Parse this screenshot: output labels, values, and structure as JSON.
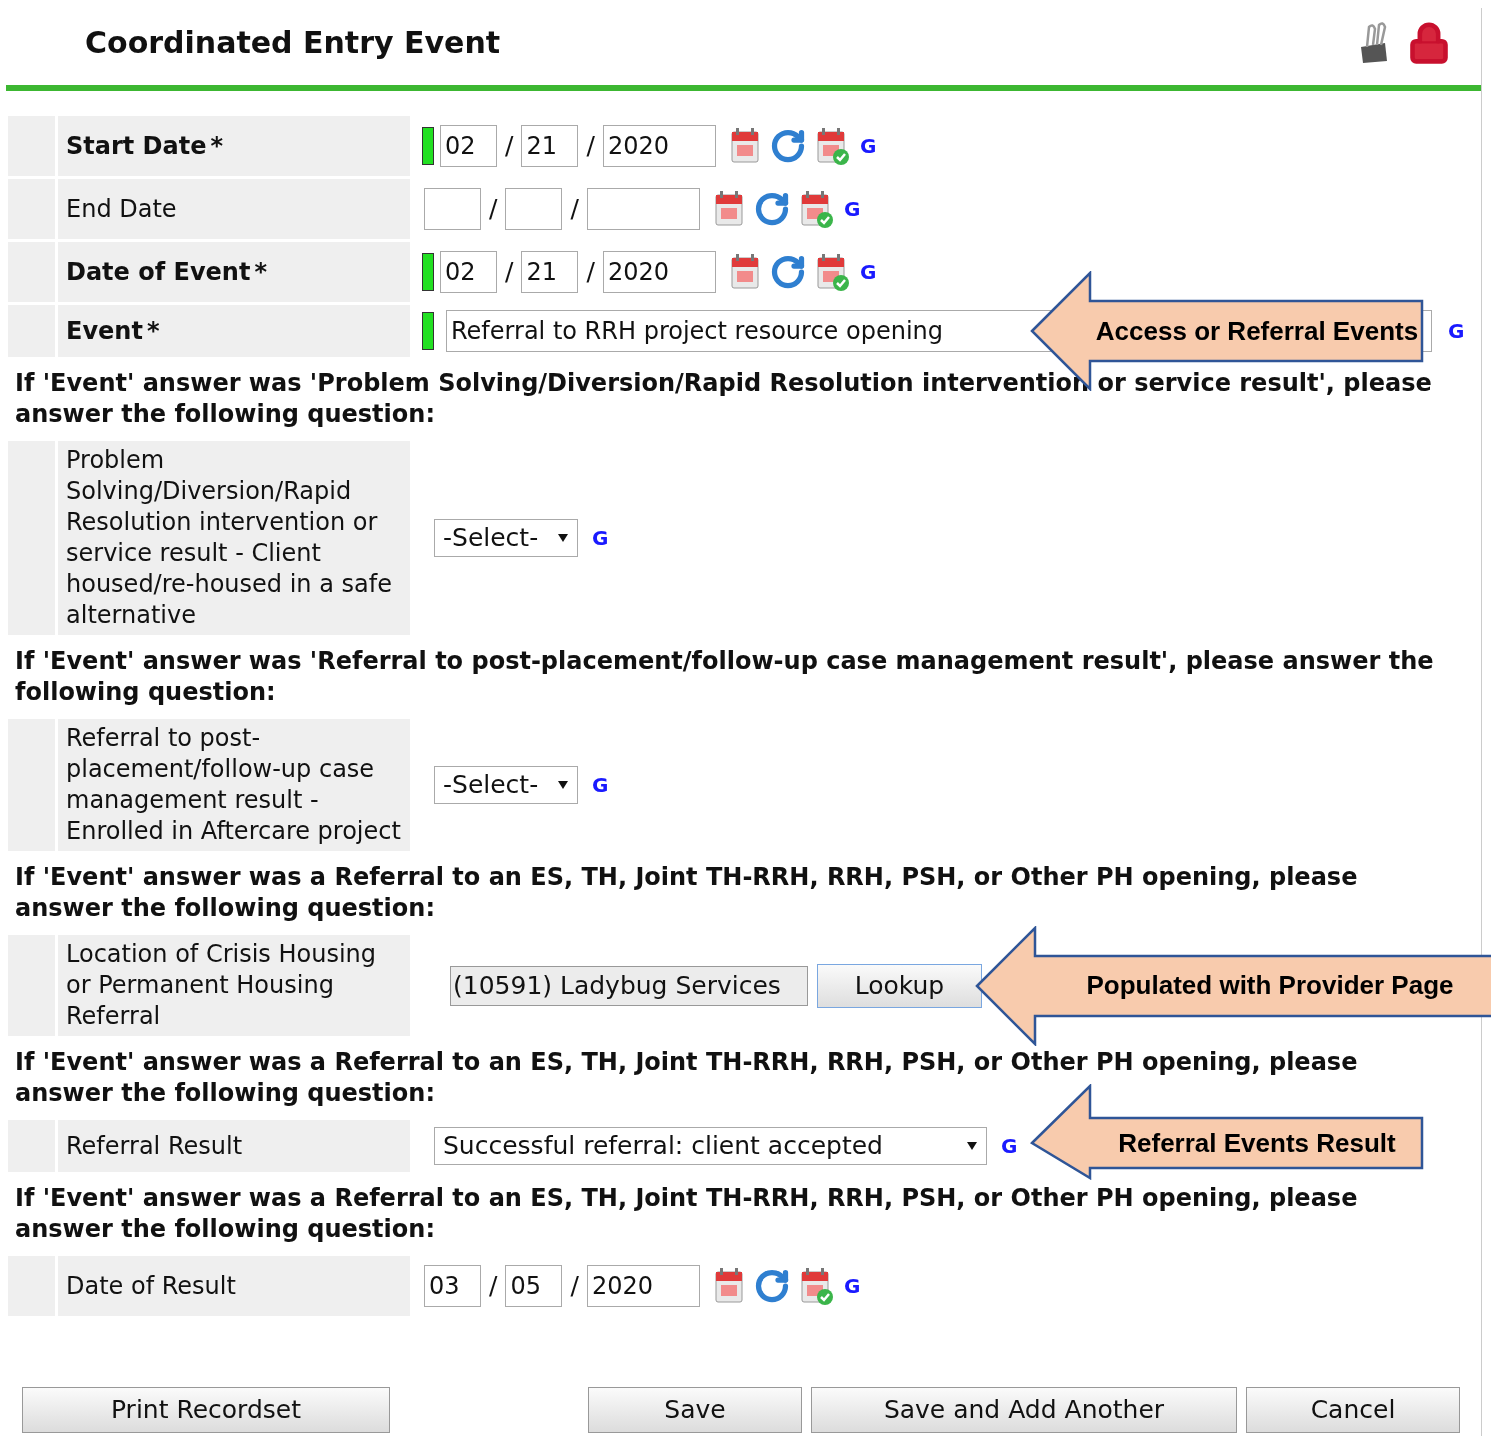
{
  "title": "Coordinated Entry Event",
  "date_separator": "/",
  "items": [
    {
      "kind": "date",
      "label": "Start Date",
      "required": true,
      "required_mark": "*",
      "month": "02",
      "day": "21",
      "year": "2020",
      "g": "G"
    },
    {
      "kind": "date",
      "label": "End Date",
      "required": false,
      "g": "G"
    },
    {
      "kind": "date",
      "label": "Date of Event",
      "required": true,
      "required_mark": "*",
      "month": "02",
      "day": "21",
      "year": "2020",
      "g": "G"
    },
    {
      "kind": "text",
      "label": "Event",
      "required": true,
      "required_mark": "*",
      "value": "Referral to RRH project resource opening",
      "g": "G",
      "callout": "Access or Referral Events"
    },
    {
      "kind": "heading",
      "text": "If 'Event' answer was 'Problem Solving/Diversion/Rapid Resolution intervention or service result', please answer the following question:"
    },
    {
      "kind": "select",
      "label": "Problem Solving/Diversion/Rapid Resolution intervention or service result - Client housed/re-housed in a safe alternative",
      "required": false,
      "value": "-Select-",
      "g": "G"
    },
    {
      "kind": "heading",
      "text": "If 'Event' answer was 'Referral to post-placement/follow-up case management result', please answer the following question:"
    },
    {
      "kind": "select",
      "label": "Referral to post-placement/follow-up case management result - Enrolled in Aftercare project",
      "required": false,
      "value": "-Select-",
      "g": "G"
    },
    {
      "kind": "heading",
      "text": "If 'Event' answer was a Referral to an ES, TH, Joint TH-RRH, RRH, PSH, or Other PH opening, please answer the following question:"
    },
    {
      "kind": "lookup",
      "label": "Location of Crisis Housing or Permanent Housing Referral",
      "required": false,
      "value": "(10591) Ladybug Services",
      "button": "Lookup",
      "callout": "Populated with Provider Page"
    },
    {
      "kind": "heading",
      "text": "If 'Event' answer was a Referral to an ES, TH, Joint TH-RRH, RRH, PSH, or Other PH opening, please answer the following question:"
    },
    {
      "kind": "select",
      "label": "Referral Result",
      "required": false,
      "value": "Successful referral: client accepted",
      "g": "G",
      "callout": "Referral Events Result"
    },
    {
      "kind": "heading",
      "text": "If 'Event' answer was a Referral to an ES, TH, Joint TH-RRH, RRH, PSH, or Other PH opening, please answer the following question:"
    },
    {
      "kind": "date",
      "label": "Date of Result",
      "required": false,
      "month": "03",
      "day": "05",
      "year": "2020",
      "g": "G"
    }
  ],
  "buttons": [
    {
      "label": "Print Recordset"
    },
    {
      "label": "Save"
    },
    {
      "label": "Save and Add Another"
    },
    {
      "label": "Cancel"
    }
  ]
}
